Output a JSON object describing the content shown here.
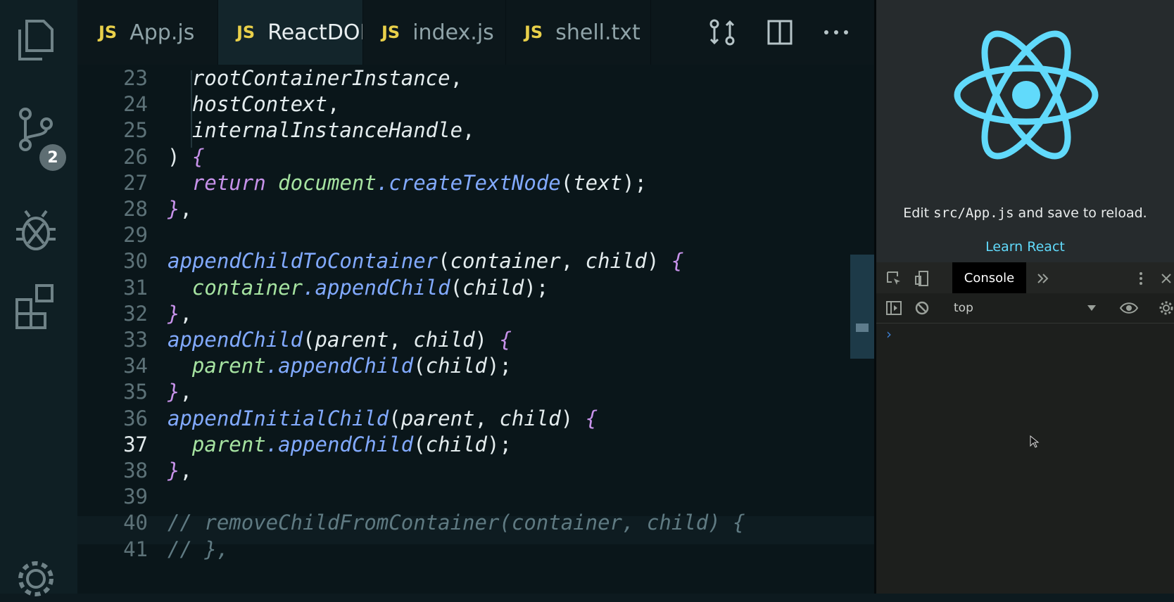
{
  "activity_bar": {
    "scm_badge": "2"
  },
  "tabs": [
    {
      "icon": "JS",
      "label": "App.js",
      "active": false
    },
    {
      "icon": "JS",
      "label": "ReactDOM",
      "active": true
    },
    {
      "icon": "JS",
      "label": "index.js",
      "active": false
    },
    {
      "icon": "JS",
      "label": "shell.txt",
      "active": false
    }
  ],
  "tab_actions": [
    "compare-changes-icon",
    "split-editor-icon",
    "more-actions-icon"
  ],
  "editor": {
    "current_line": "37",
    "lines": [
      {
        "n": "23",
        "text": "  rootContainerInstance,"
      },
      {
        "n": "24",
        "text": "  hostContext,"
      },
      {
        "n": "25",
        "text": "  internalInstanceHandle,"
      },
      {
        "n": "26",
        "text": ") {"
      },
      {
        "n": "27",
        "text": "  return document.createTextNode(text);"
      },
      {
        "n": "28",
        "text": "},"
      },
      {
        "n": "29",
        "text": ""
      },
      {
        "n": "30",
        "text": "appendChildToContainer(container, child) {"
      },
      {
        "n": "31",
        "text": "  container.appendChild(child);"
      },
      {
        "n": "32",
        "text": "},"
      },
      {
        "n": "33",
        "text": "appendChild(parent, child) {"
      },
      {
        "n": "34",
        "text": "  parent.appendChild(child);"
      },
      {
        "n": "35",
        "text": "},"
      },
      {
        "n": "36",
        "text": "appendInitialChild(parent, child) {"
      },
      {
        "n": "37",
        "text": "  parent.appendChild(child);"
      },
      {
        "n": "38",
        "text": "},"
      },
      {
        "n": "39",
        "text": ""
      },
      {
        "n": "40",
        "text": "// removeChildFromContainer(container, child) {"
      },
      {
        "n": "41",
        "text": "// },"
      }
    ]
  },
  "preview": {
    "edit_text_before": "Edit ",
    "edit_code": "src/App.js",
    "edit_text_after": " and save to reload.",
    "learn_link": "Learn React",
    "logo_color": "#61dafb"
  },
  "devtools": {
    "active_tab": "Console",
    "context": "top",
    "prompt": "›"
  },
  "colors": {
    "keyword": "#c792ea",
    "function": "#82aaff",
    "object": "#a6e3a1",
    "param": "#e4ecee",
    "comment": "#5f7a82"
  }
}
